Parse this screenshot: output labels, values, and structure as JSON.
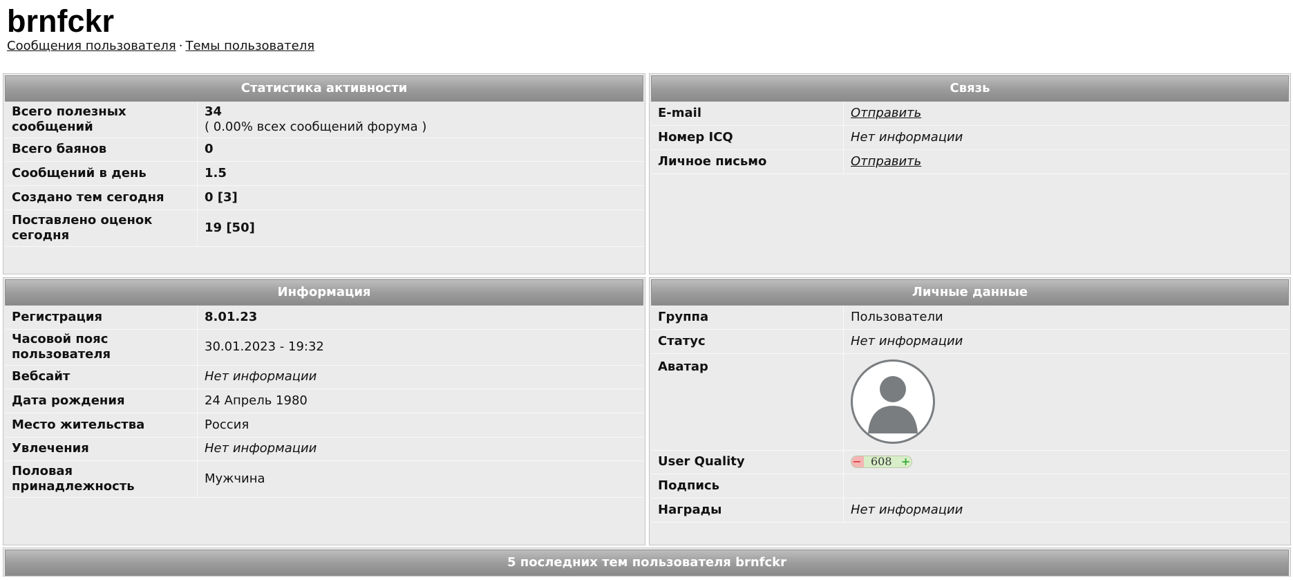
{
  "profile": {
    "username": "brnfckr",
    "link_posts": "Сообщения пользователя",
    "link_separator": "·",
    "link_topics": "Темы пользователя"
  },
  "stats": {
    "title": "Статистика активности",
    "rows": [
      {
        "label": "Всего полезных сообщений",
        "value": "34",
        "note": "( 0.00% всех сообщений форума )"
      },
      {
        "label": "Всего баянов",
        "value": "0"
      },
      {
        "label": "Сообщений в день",
        "value": "1.5"
      },
      {
        "label": "Создано тем сегодня",
        "value": "0 [3]"
      },
      {
        "label": "Поставлено оценок сегодня",
        "value": "19 [50]"
      }
    ]
  },
  "contact": {
    "title": "Связь",
    "rows": [
      {
        "label": "E-mail",
        "value": "Отправить"
      },
      {
        "label": "Номер ICQ",
        "value": "Нет информации"
      },
      {
        "label": "Личное письмо",
        "value": "Отправить"
      }
    ]
  },
  "info": {
    "title": "Информация",
    "rows": [
      {
        "label": "Регистрация",
        "value": "8.01.23"
      },
      {
        "label": "Часовой пояс пользователя",
        "value": "30.01.2023 - 19:32"
      },
      {
        "label": "Вебсайт",
        "value": "Нет информации"
      },
      {
        "label": "Дата рождения",
        "value": "24 Апрель 1980"
      },
      {
        "label": "Место жительства",
        "value": "Россия"
      },
      {
        "label": "Увлечения",
        "value": "Нет информации"
      },
      {
        "label": "Половая принадлежность",
        "value": "Мужчина"
      }
    ]
  },
  "personal": {
    "title": "Личные данные",
    "rows": [
      {
        "label": "Группа",
        "value": "Пользователи"
      },
      {
        "label": "Статус",
        "value": "Нет информации"
      },
      {
        "label": "Аватар",
        "value": "avatar-icon"
      },
      {
        "label": "User Quality",
        "value": "608",
        "minus": "−",
        "plus": "+"
      },
      {
        "label": "Подпись",
        "value": ""
      },
      {
        "label": "Награды",
        "value": "Нет информации"
      }
    ]
  },
  "recent": {
    "title": "5 последних тем пользователя brnfckr"
  },
  "colors": {
    "header_gradient_top": "#bdbdbd",
    "header_gradient_bottom": "#8a8a8a",
    "panel_bg": "#ebebeb",
    "avatar_ring": "#7a7d80"
  }
}
